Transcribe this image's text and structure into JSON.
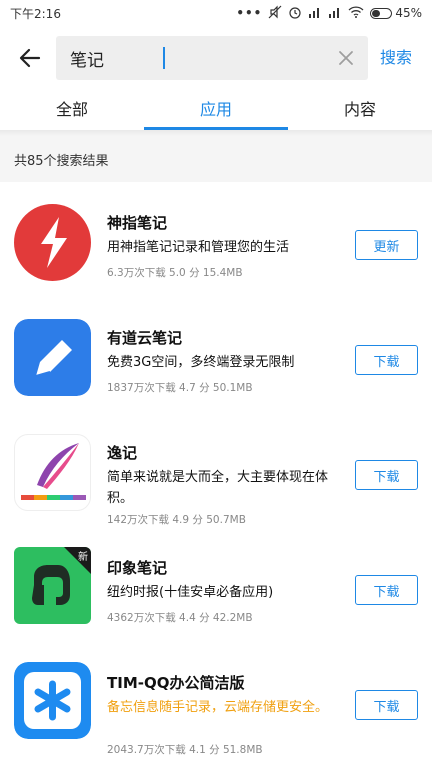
{
  "status_bar": {
    "time": "下午2:16",
    "battery": "45%",
    "battery_level": 0.45
  },
  "search": {
    "query": "笔记",
    "search_label": "搜索"
  },
  "tabs": [
    {
      "label": "全部",
      "active": false
    },
    {
      "label": "应用",
      "active": true
    },
    {
      "label": "内容",
      "active": false
    }
  ],
  "results_count": "共85个搜索结果",
  "apps": [
    {
      "name": "神指笔记",
      "desc": "用神指笔记记录和管理您的生活",
      "meta": "6.3万次下载  5.0 分   15.4MB",
      "button": "更新",
      "icon": "lightning-icon",
      "desc_color": "#111111"
    },
    {
      "name": "有道云笔记",
      "desc": "免费3G空间，多终端登录无限制",
      "meta": "1837万次下载  4.7 分   50.1MB",
      "button": "下载",
      "icon": "pen-icon",
      "desc_color": "#111111"
    },
    {
      "name": "逸记",
      "desc": "简单来说就是大而全，大主要体现在体积。",
      "meta": "142万次下载  4.9 分   50.7MB",
      "button": "下载",
      "icon": "feather-icon",
      "desc_color": "#111111"
    },
    {
      "name": "印象笔记",
      "desc": "纽约时报(十佳安卓必备应用)",
      "meta": "4362万次下载  4.4 分   42.2MB",
      "button": "下载",
      "icon": "elephant-icon",
      "badge": "新",
      "desc_color": "#111111"
    },
    {
      "name": "TIM-QQ办公简洁版",
      "desc": "备忘信息随手记录，云端存储更安全。",
      "meta": "2043.7万次下载  4.1 分   51.8MB",
      "button": "下载",
      "icon": "asterisk-icon",
      "desc_color": "#f0a010"
    }
  ]
}
